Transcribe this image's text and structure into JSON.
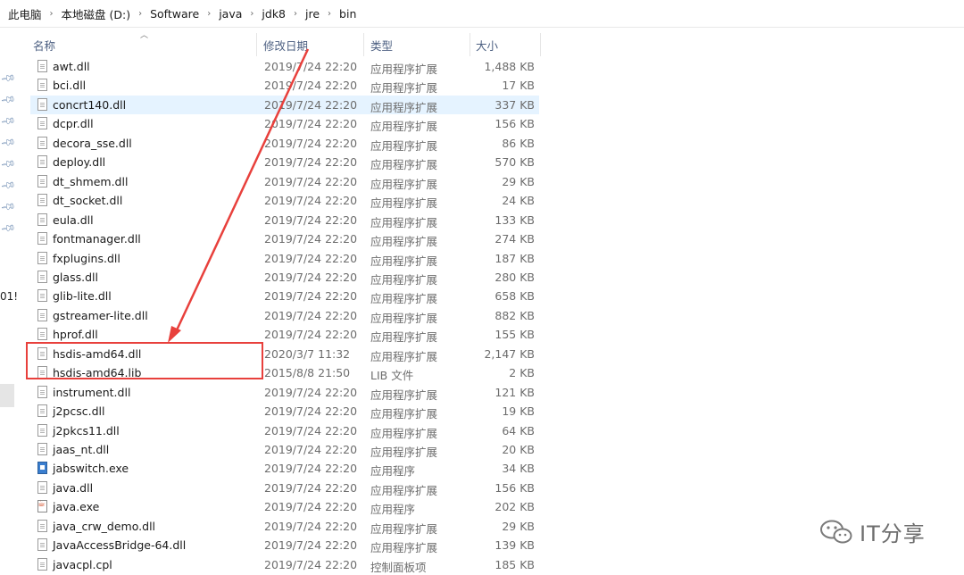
{
  "breadcrumb": [
    "此电脑",
    "本地磁盘 (D:)",
    "Software",
    "java",
    "jdk8",
    "jre",
    "bin"
  ],
  "nav": {
    "partial_text": "01!"
  },
  "columns": {
    "name": "名称",
    "date": "修改日期",
    "type": "类型",
    "size": "大小"
  },
  "files": [
    {
      "name": "awt.dll",
      "date": "2019/7/24 22:20",
      "type": "应用程序扩展",
      "size": "1,488 KB",
      "icon": "dll-file-icon"
    },
    {
      "name": "bci.dll",
      "date": "2019/7/24 22:20",
      "type": "应用程序扩展",
      "size": "17 KB",
      "icon": "dll-file-icon"
    },
    {
      "name": "concrt140.dll",
      "date": "2019/7/24 22:20",
      "type": "应用程序扩展",
      "size": "337 KB",
      "icon": "dll-file-icon",
      "selected": true
    },
    {
      "name": "dcpr.dll",
      "date": "2019/7/24 22:20",
      "type": "应用程序扩展",
      "size": "156 KB",
      "icon": "dll-file-icon"
    },
    {
      "name": "decora_sse.dll",
      "date": "2019/7/24 22:20",
      "type": "应用程序扩展",
      "size": "86 KB",
      "icon": "dll-file-icon"
    },
    {
      "name": "deploy.dll",
      "date": "2019/7/24 22:20",
      "type": "应用程序扩展",
      "size": "570 KB",
      "icon": "dll-file-icon"
    },
    {
      "name": "dt_shmem.dll",
      "date": "2019/7/24 22:20",
      "type": "应用程序扩展",
      "size": "29 KB",
      "icon": "dll-file-icon"
    },
    {
      "name": "dt_socket.dll",
      "date": "2019/7/24 22:20",
      "type": "应用程序扩展",
      "size": "24 KB",
      "icon": "dll-file-icon"
    },
    {
      "name": "eula.dll",
      "date": "2019/7/24 22:20",
      "type": "应用程序扩展",
      "size": "133 KB",
      "icon": "dll-file-icon"
    },
    {
      "name": "fontmanager.dll",
      "date": "2019/7/24 22:20",
      "type": "应用程序扩展",
      "size": "274 KB",
      "icon": "dll-file-icon"
    },
    {
      "name": "fxplugins.dll",
      "date": "2019/7/24 22:20",
      "type": "应用程序扩展",
      "size": "187 KB",
      "icon": "dll-file-icon"
    },
    {
      "name": "glass.dll",
      "date": "2019/7/24 22:20",
      "type": "应用程序扩展",
      "size": "280 KB",
      "icon": "dll-file-icon"
    },
    {
      "name": "glib-lite.dll",
      "date": "2019/7/24 22:20",
      "type": "应用程序扩展",
      "size": "658 KB",
      "icon": "dll-file-icon"
    },
    {
      "name": "gstreamer-lite.dll",
      "date": "2019/7/24 22:20",
      "type": "应用程序扩展",
      "size": "882 KB",
      "icon": "dll-file-icon"
    },
    {
      "name": "hprof.dll",
      "date": "2019/7/24 22:20",
      "type": "应用程序扩展",
      "size": "155 KB",
      "icon": "dll-file-icon"
    },
    {
      "name": "hsdis-amd64.dll",
      "date": "2020/3/7 11:32",
      "type": "应用程序扩展",
      "size": "2,147 KB",
      "icon": "dll-file-icon"
    },
    {
      "name": "hsdis-amd64.lib",
      "date": "2015/8/8 21:50",
      "type": "LIB 文件",
      "size": "2 KB",
      "icon": "lib-file-icon"
    },
    {
      "name": "instrument.dll",
      "date": "2019/7/24 22:20",
      "type": "应用程序扩展",
      "size": "121 KB",
      "icon": "dll-file-icon"
    },
    {
      "name": "j2pcsc.dll",
      "date": "2019/7/24 22:20",
      "type": "应用程序扩展",
      "size": "19 KB",
      "icon": "dll-file-icon"
    },
    {
      "name": "j2pkcs11.dll",
      "date": "2019/7/24 22:20",
      "type": "应用程序扩展",
      "size": "64 KB",
      "icon": "dll-file-icon"
    },
    {
      "name": "jaas_nt.dll",
      "date": "2019/7/24 22:20",
      "type": "应用程序扩展",
      "size": "20 KB",
      "icon": "dll-file-icon"
    },
    {
      "name": "jabswitch.exe",
      "date": "2019/7/24 22:20",
      "type": "应用程序",
      "size": "34 KB",
      "icon": "exe-file-icon"
    },
    {
      "name": "java.dll",
      "date": "2019/7/24 22:20",
      "type": "应用程序扩展",
      "size": "156 KB",
      "icon": "dll-file-icon"
    },
    {
      "name": "java.exe",
      "date": "2019/7/24 22:20",
      "type": "应用程序",
      "size": "202 KB",
      "icon": "java-exe-icon"
    },
    {
      "name": "java_crw_demo.dll",
      "date": "2019/7/24 22:20",
      "type": "应用程序扩展",
      "size": "29 KB",
      "icon": "dll-file-icon"
    },
    {
      "name": "JavaAccessBridge-64.dll",
      "date": "2019/7/24 22:20",
      "type": "应用程序扩展",
      "size": "139 KB",
      "icon": "dll-file-icon"
    },
    {
      "name": "javacpl.cpl",
      "date": "2019/7/24 22:20",
      "type": "控制面板项",
      "size": "185 KB",
      "icon": "cpl-file-icon"
    }
  ],
  "annotation": {
    "color": "#e8403c"
  },
  "watermark": {
    "text": "IT分享",
    "icon": "wechat-icon"
  }
}
